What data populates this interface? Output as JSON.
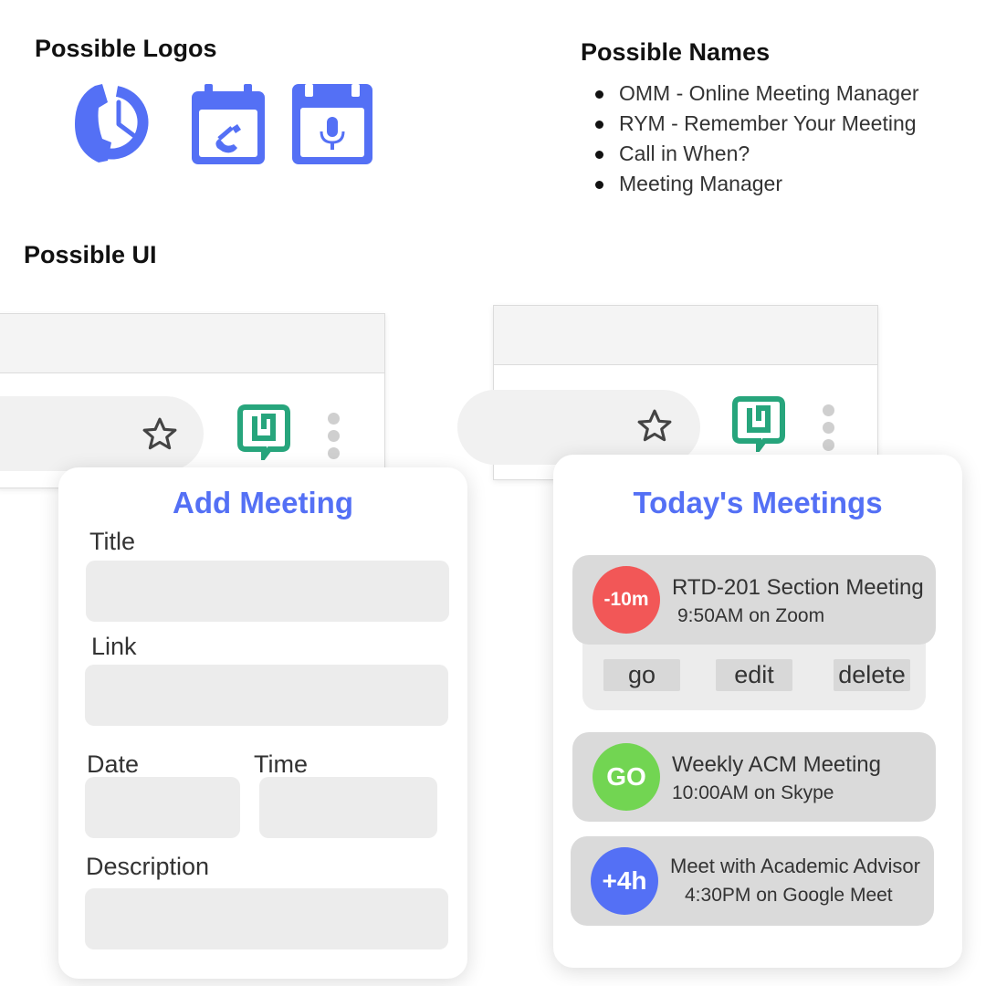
{
  "logos": {
    "heading": "Possible Logos",
    "items": [
      {
        "name": "phone-clock-icon"
      },
      {
        "name": "calendar-phone-icon"
      },
      {
        "name": "calendar-mic-icon"
      }
    ],
    "color": "#5470f5"
  },
  "names": {
    "heading": "Possible Names",
    "items": [
      "OMM - Online Meeting Manager",
      "RYM - Remember Your Meeting",
      "Call in When?",
      "Meeting Manager"
    ]
  },
  "ui": {
    "heading": "Possible UI"
  },
  "add_meeting": {
    "title": "Add Meeting",
    "fields": {
      "title_label": "Title",
      "link_label": "Link",
      "date_label": "Date",
      "time_label": "Time",
      "description_label": "Description"
    }
  },
  "todays_meetings": {
    "title": "Today's Meetings",
    "meetings": [
      {
        "badge": "-10m",
        "badge_color": "#f25757",
        "title": "RTD-201 Section Meeting",
        "subtitle": "9:50AM on Zoom"
      },
      {
        "badge": "GO",
        "badge_color": "#72d552",
        "title": "Weekly ACM Meeting",
        "subtitle": "10:00AM on Skype"
      },
      {
        "badge": "+4h",
        "badge_color": "#5470f5",
        "title": "Meet with Academic Advisor",
        "subtitle": "4:30PM on Google Meet"
      }
    ],
    "actions": {
      "go": "go",
      "edit": "edit",
      "delete": "delete"
    }
  },
  "colors": {
    "accent": "#5470f5",
    "extension_green": "#27a57c"
  },
  "icons": {
    "bookmark": "star-icon",
    "extension": "extension-logo-icon",
    "menu": "kebab-menu-icon"
  }
}
